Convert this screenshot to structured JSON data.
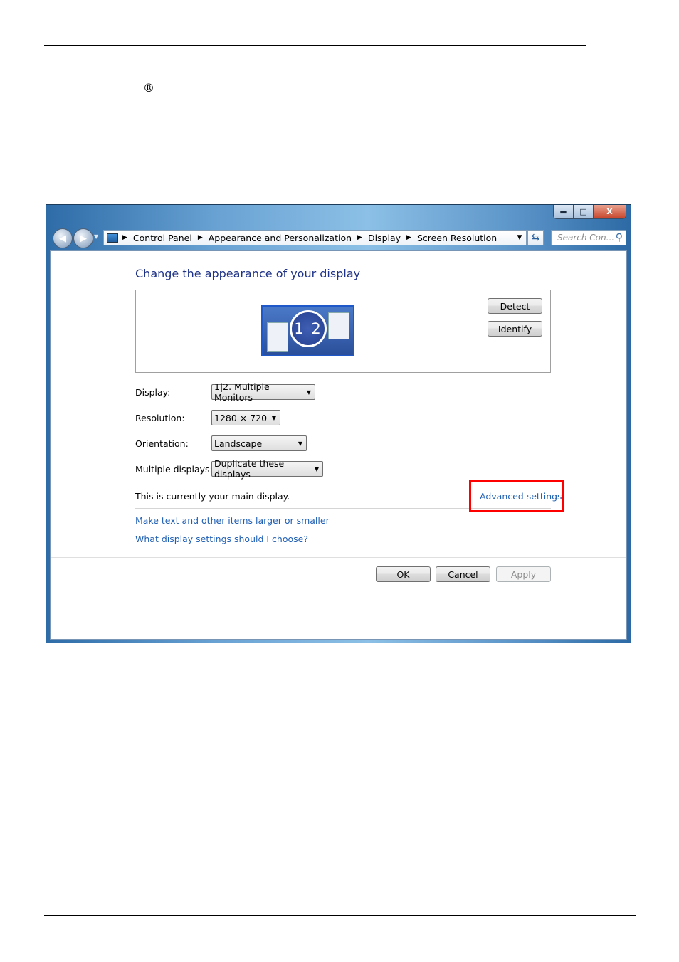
{
  "page": {
    "registered_mark": "®"
  },
  "window": {
    "caption_buttons": {
      "minimize": "▬",
      "maximize": "□",
      "close": "X"
    },
    "nav": {
      "back_icon": "arrow-left",
      "forward_icon": "arrow-right",
      "history_icon": "chevron-down"
    },
    "breadcrumbs": [
      "Control Panel",
      "Appearance and Personalization",
      "Display",
      "Screen Resolution"
    ],
    "search_placeholder": "Search Con...",
    "heading": "Change the appearance of your display",
    "monitor_preview": {
      "label": "1 2"
    },
    "buttons": {
      "detect": "Detect",
      "identify": "Identify",
      "ok": "OK",
      "cancel": "Cancel",
      "apply": "Apply"
    },
    "fields": {
      "display": {
        "label": "Display:",
        "value": "1|2. Multiple Monitors"
      },
      "resolution": {
        "label": "Resolution:",
        "value": "1280 × 720"
      },
      "orientation": {
        "label": "Orientation:",
        "value": "Landscape"
      },
      "multiple_displays": {
        "label": "Multiple displays:",
        "value": "Duplicate these displays"
      }
    },
    "main_display_text": "This is currently your main display.",
    "advanced_link": "Advanced settings",
    "links": [
      "Make text and other items larger or smaller",
      "What display settings should I choose?"
    ]
  },
  "colors": {
    "highlight": "#ff0000",
    "link": "#1f5fb4",
    "heading": "#1e3287"
  }
}
